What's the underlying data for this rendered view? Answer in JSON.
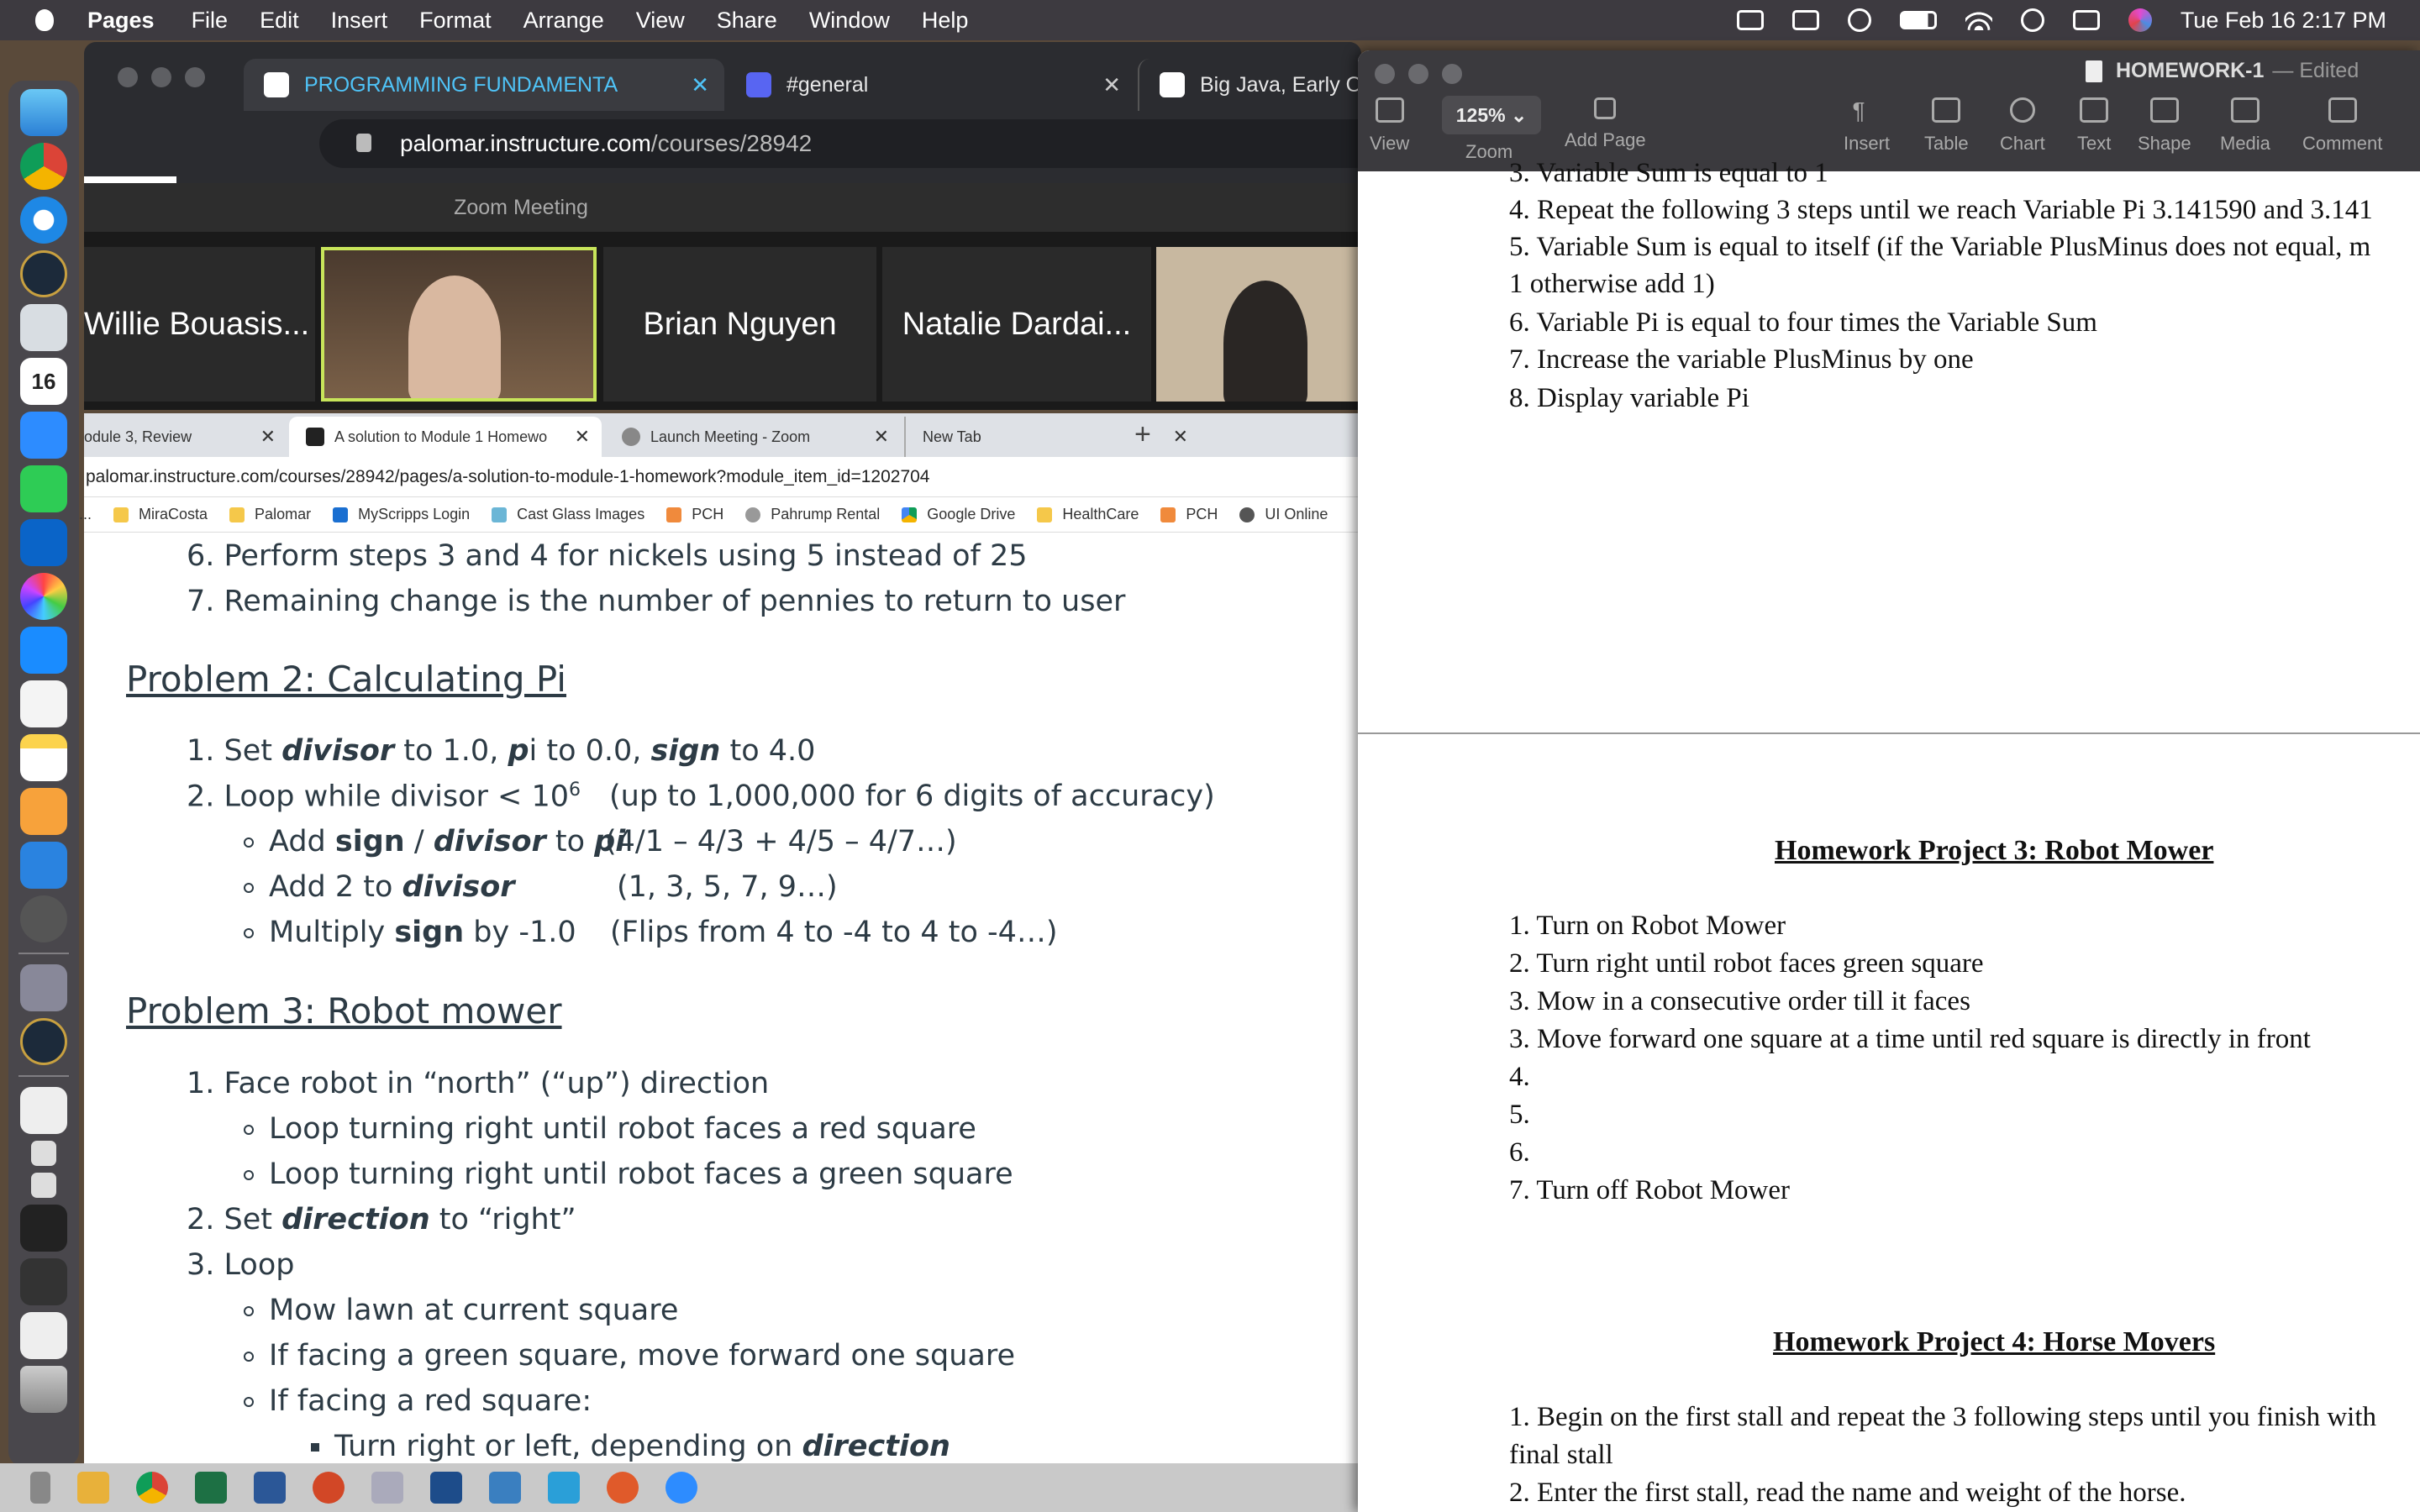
{
  "menubar": {
    "app": "Pages",
    "items": [
      "File",
      "Edit",
      "Insert",
      "Format",
      "Arrange",
      "View",
      "Share",
      "Window",
      "Help"
    ],
    "clock": "Tue Feb 16  2:17 PM"
  },
  "browser": {
    "tabs": [
      {
        "label": "PROGRAMMING FUNDAMENTA"
      },
      {
        "label": "#general"
      },
      {
        "label": "Big Java, Early Objects, En"
      }
    ],
    "url_host": "palomar.instructure.com",
    "url_path": "/courses/28942"
  },
  "zoom": {
    "title": "Zoom Meeting",
    "participants": [
      "Willie Bouasis...",
      "Brian Nguyen",
      "Natalie Dardai..."
    ]
  },
  "browser2": {
    "tabs": [
      {
        "label": "odule 3, Review"
      },
      {
        "label": "A solution to Module 1 Homewo"
      },
      {
        "label": "Launch Meeting - Zoom"
      },
      {
        "label": "New Tab"
      }
    ],
    "url": "palomar.instructure.com/courses/28942/pages/a-solution-to-module-1-homework?module_item_id=1202704",
    "bookmarks": [
      "MiraCosta",
      "Palomar",
      "MyScripps Login",
      "Cast Glass Images",
      "PCH",
      "Pahrump Rental",
      "Google Drive",
      "HealthCare",
      "PCH",
      "UI Online"
    ]
  },
  "canvas": {
    "p1_step6": "6. Perform steps 3 and 4 for nickels using 5 instead of 25",
    "p1_step7": "7. Remaining change is the number of pennies to return to user",
    "p2_heading": "Problem 2: Calculating Pi",
    "p2_s1_a": "1. Set ",
    "p2_s1_b": "divisor",
    "p2_s1_c": " to 1.0, ",
    "p2_s1_d": "p",
    "p2_s1_e": "i to 0.0, ",
    "p2_s1_f": "sign",
    "p2_s1_g": " to 4.0",
    "p2_s2_a": "2. Loop while divisor < 10",
    "p2_s2_sup": "6",
    "p2_s2_note": "(up to 1,000,000 for 6 digits of accuracy)",
    "p2_b1_a": "Add ",
    "p2_b1_b": "sign",
    "p2_b1_c": " / ",
    "p2_b1_d": "divisor",
    "p2_b1_e": " to ",
    "p2_b1_f": "pi",
    "p2_b1_note": "(4/1 – 4/3 + 4/5 – 4/7…)",
    "p2_b2_a": "Add 2 to ",
    "p2_b2_b": "divisor",
    "p2_b2_note": "(1, 3, 5, 7, 9…)",
    "p2_b3_a": "Multiply ",
    "p2_b3_b": "sign",
    "p2_b3_c": " by -1.0",
    "p2_b3_note": "(Flips from 4 to -4 to 4 to -4…)",
    "p3_heading": "Problem 3: Robot mower",
    "p3_s1": "1. Face robot in “north” (“up”) direction",
    "p3_s1_b1": "Loop turning right until robot faces a red square",
    "p3_s1_b2": "Loop turning right until robot faces a green square",
    "p3_s2_a": "2. Set ",
    "p3_s2_b": "direction",
    "p3_s2_c": " to “right”",
    "p3_s3": "3. Loop",
    "p3_s3_b1": "Mow lawn at current square",
    "p3_s3_b2": "If facing a green square, move forward one square",
    "p3_s3_b3": "If facing a red square:",
    "p3_s3_sub1_a": "Turn right or left, depending on ",
    "p3_s3_sub1_b": "direction"
  },
  "pages": {
    "doc_title": "HOMEWORK-1",
    "edited": "— Edited",
    "zoom": "125%",
    "tools": [
      "View",
      "Zoom",
      "Add Page",
      "Insert",
      "Table",
      "Chart",
      "Text",
      "Shape",
      "Media",
      "Comment"
    ]
  },
  "doc": {
    "pi_lines": [
      "3. Variable Sum is equal to 1",
      "4. Repeat the following 3 steps until we reach Variable Pi 3.141590 and 3.141",
      "5. Variable Sum is equal to itself (if the Variable PlusMinus does not equal, m",
      "1 otherwise add 1)",
      "6. Variable Pi is equal to four times the Variable Sum",
      "7. Increase the variable PlusMinus by one",
      "8. Display variable Pi"
    ],
    "p3_heading": "Homework Project 3: Robot Mower",
    "p3_lines": [
      "1. Turn on Robot Mower",
      "2. Turn right until robot faces green square",
      "3. Mow in a consecutive order till it faces",
      "3. Move forward one square at a time until red square is directly in front",
      "4.",
      "5.",
      "6.",
      "7. Turn off Robot Mower"
    ],
    "p4_heading": "Homework Project 4: Horse Movers",
    "p4_lines": [
      "1. Begin on the first stall and repeat the 3 following steps until you finish with",
      "final stall",
      "2. Enter the first stall, read the name and weight of the horse."
    ]
  },
  "colors": {
    "menubar": "#3d3a40",
    "canvas_text": "#2d3b45",
    "zoom_active_border": "#c8e55a"
  },
  "icons": [
    "apple-icon",
    "finder-icon",
    "chrome-icon",
    "safari-icon",
    "calendar-icon",
    "zoom-icon",
    "facetime-icon",
    "outlook-icon",
    "photos-icon",
    "appstore-icon",
    "textedit-icon",
    "notes-icon",
    "pages-icon",
    "keynote-icon",
    "trash-icon"
  ]
}
